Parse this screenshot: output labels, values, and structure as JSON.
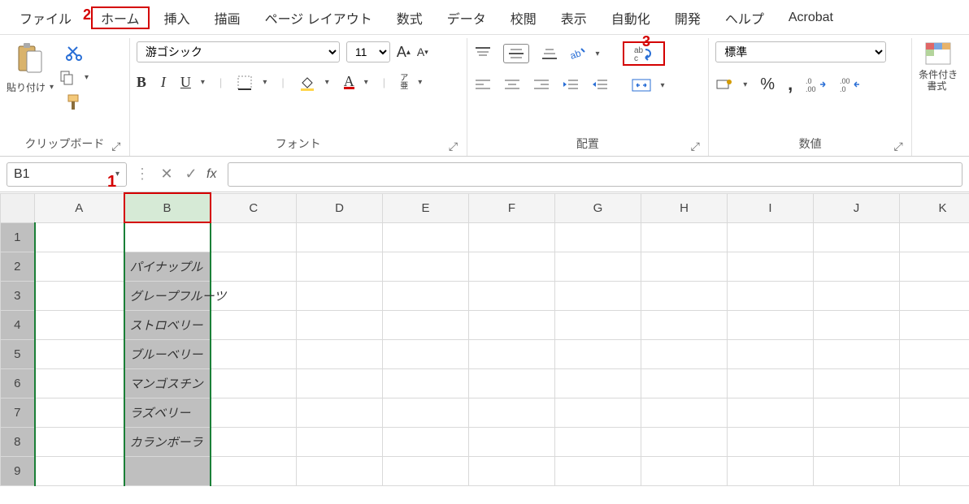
{
  "annotations": {
    "one": "1",
    "two": "2",
    "three": "3"
  },
  "tabs": {
    "file": "ファイル",
    "home": "ホーム",
    "insert": "挿入",
    "draw": "描画",
    "pagelayout": "ページ レイアウト",
    "formulas": "数式",
    "data": "データ",
    "review": "校閲",
    "view": "表示",
    "automate": "自動化",
    "developer": "開発",
    "help": "ヘルプ",
    "acrobat": "Acrobat"
  },
  "ribbon": {
    "clipboard": {
      "paste": "貼り付け",
      "label": "クリップボード"
    },
    "font": {
      "name": "游ゴシック",
      "size": "11",
      "phonetic": "ア\n亜",
      "label": "フォント"
    },
    "alignment": {
      "label": "配置"
    },
    "number": {
      "format": "標準",
      "label": "数値"
    },
    "styles": {
      "condfmt": "条件付き\n書式 "
    }
  },
  "namebox": "B1",
  "columns": [
    "A",
    "B",
    "C",
    "D",
    "E",
    "F",
    "G",
    "H",
    "I",
    "J",
    "K"
  ],
  "rows": [
    "1",
    "2",
    "3",
    "4",
    "5",
    "6",
    "7",
    "8",
    "9"
  ],
  "cells": {
    "b2": "パイナップル",
    "b3": "グレープフルーツ",
    "b4": "ストロベリー",
    "b5": "ブルーベリー",
    "b6": "マンゴスチン",
    "b7": "ラズベリー",
    "b8": "カランボーラ"
  }
}
